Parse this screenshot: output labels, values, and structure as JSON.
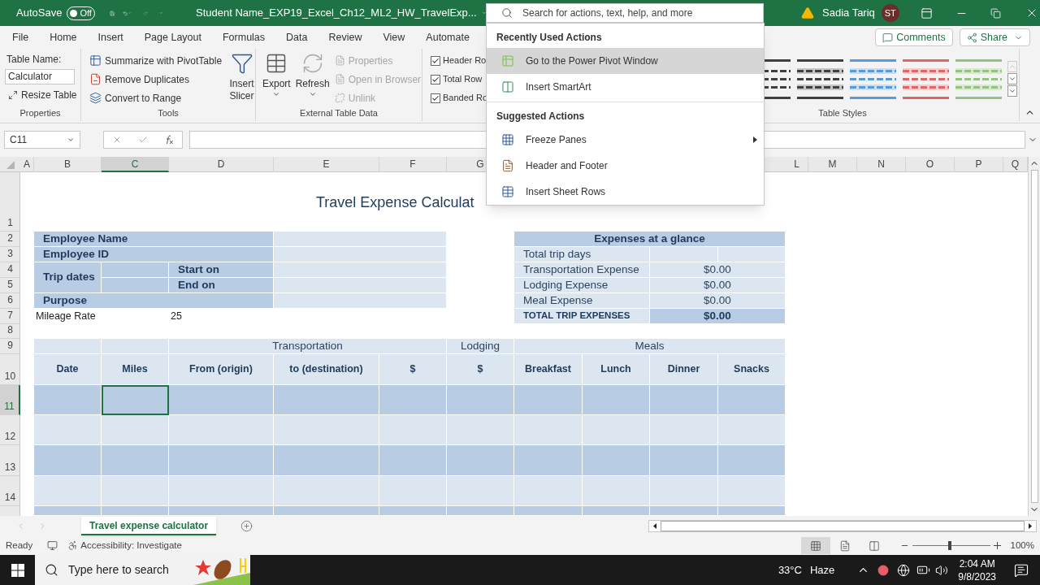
{
  "title_bar": {
    "autosave_label": "AutoSave",
    "autosave": {
      "on": false,
      "label": "Off"
    },
    "file_name": "Student Name_EXP19_Excel_Ch12_ML2_HW_TravelExp...",
    "user_name": "Sadia Tariq",
    "user_initials": "ST"
  },
  "search": {
    "placeholder": "Search for actions, text, help, and more",
    "sections": [
      {
        "heading": "Recently Used Actions",
        "items": [
          {
            "kind": "pivot",
            "label": "Go to the Power Pivot Window",
            "selected": true,
            "submenu": false
          },
          {
            "kind": "smartart",
            "label": "Insert SmartArt",
            "selected": false,
            "submenu": false
          }
        ]
      },
      {
        "heading": "Suggested Actions",
        "items": [
          {
            "kind": "freeze",
            "label": "Freeze Panes",
            "selected": false,
            "submenu": true
          },
          {
            "kind": "header",
            "label": "Header and Footer",
            "selected": false,
            "submenu": false
          },
          {
            "kind": "rows",
            "label": "Insert Sheet Rows",
            "selected": false,
            "submenu": false
          }
        ]
      }
    ]
  },
  "menu_tabs": [
    "File",
    "Home",
    "Insert",
    "Page Layout",
    "Formulas",
    "Data",
    "Review",
    "View",
    "Automate"
  ],
  "comments_button": "Comments",
  "share_button": "Share",
  "ribbon": {
    "properties": {
      "title": "Properties",
      "table_name_label": "Table Name:",
      "table_name": "Calculator",
      "resize": "Resize Table"
    },
    "tools": {
      "title": "Tools",
      "commands": [
        {
          "kind": "pivot",
          "label": "Summarize with PivotTable"
        },
        {
          "kind": "duplicates",
          "label": "Remove Duplicates"
        },
        {
          "kind": "range",
          "label": "Convert to Range"
        }
      ],
      "slicer": "Insert Slicer"
    },
    "external": {
      "title": "External Table Data",
      "export": "Export",
      "refresh": "Refresh",
      "commands": [
        {
          "label": "Properties",
          "disabled": true
        },
        {
          "label": "Open in Browser",
          "disabled": true
        },
        {
          "label": "Unlink",
          "disabled": true
        }
      ]
    },
    "style_options": [
      {
        "label": "Header Ro",
        "checked": true
      },
      {
        "label": "Total Row",
        "checked": true
      },
      {
        "label": "Banded Ro",
        "checked": true
      }
    ],
    "table_styles": {
      "title": "Table Styles",
      "swatches": [
        {
          "color": "#404040"
        },
        {
          "color": "#404040"
        },
        {
          "color": "#5b9bd5"
        },
        {
          "color": "#e06666"
        },
        {
          "color": "#93c47d"
        }
      ]
    }
  },
  "formula_bar": {
    "name_box": "C11"
  },
  "sheet": {
    "columns": [
      {
        "label": "A",
        "selected": false
      },
      {
        "label": "B",
        "selected": false
      },
      {
        "label": "C",
        "selected": true
      },
      {
        "label": "D",
        "selected": false
      },
      {
        "label": "E",
        "selected": false
      },
      {
        "label": "F",
        "selected": false
      },
      {
        "label": "G",
        "selected": false
      },
      {
        "label": "L",
        "selected": false
      },
      {
        "label": "M",
        "selected": false
      },
      {
        "label": "N",
        "selected": false
      },
      {
        "label": "O",
        "selected": false
      },
      {
        "label": "P",
        "selected": false
      },
      {
        "label": "Q",
        "selected": false
      }
    ],
    "rows": [
      {
        "label": "1",
        "selected": false
      },
      {
        "label": "2",
        "selected": false
      },
      {
        "label": "3",
        "selected": false
      },
      {
        "label": "4",
        "selected": false
      },
      {
        "label": "5",
        "selected": false
      },
      {
        "label": "6",
        "selected": false
      },
      {
        "label": "7",
        "selected": false
      },
      {
        "label": "8",
        "selected": false
      },
      {
        "label": "9",
        "selected": false
      },
      {
        "label": "10",
        "selected": false
      },
      {
        "label": "11",
        "selected": true
      },
      {
        "label": "12",
        "selected": false
      },
      {
        "label": "13",
        "selected": false
      },
      {
        "label": "14",
        "selected": false
      }
    ],
    "title": "Travel Expense Calculat",
    "employee_table": {
      "name_label": "Employee Name",
      "id_label": "Employee ID",
      "trip_dates_label": "Trip dates",
      "start_label": "Start on",
      "end_label": "End on",
      "purpose_label": "Purpose"
    },
    "mileage": {
      "label": "Mileage Rate",
      "value": "25"
    },
    "expenses": {
      "title": "Expenses at a glance",
      "rows": [
        {
          "label": "Total trip days"
        },
        {
          "label": "Transportation Expense",
          "value": "$0.00"
        },
        {
          "label": "Lodging Expense",
          "value": "$0.00"
        },
        {
          "label": "Meal Expense",
          "value": "$0.00"
        }
      ],
      "total": {
        "label": "TOTAL TRIP EXPENSES",
        "value": "$0.00"
      }
    },
    "trip_table": {
      "groups": [
        "Transportation",
        "Lodging",
        "Meals"
      ],
      "columns": [
        "Date",
        "Miles",
        "From (origin)",
        "to (destination)",
        "$",
        "$",
        "Breakfast",
        "Lunch",
        "Dinner",
        "Snacks"
      ],
      "entry_rows": [
        {
          "banded": true,
          "cells": [
            {
              "selected": false
            },
            {
              "selected": true
            },
            {
              "selected": false
            },
            {
              "selected": false
            },
            {
              "selected": false
            },
            {
              "selected": false
            },
            {
              "selected": false
            },
            {
              "selected": false
            },
            {
              "selected": false
            },
            {
              "selected": false
            }
          ]
        },
        {
          "banded": false,
          "cells": [
            {
              "selected": false
            },
            {
              "selected": false
            },
            {
              "selected": false
            },
            {
              "selected": false
            },
            {
              "selected": false
            },
            {
              "selected": false
            },
            {
              "selected": false
            },
            {
              "selected": false
            },
            {
              "selected": false
            },
            {
              "selected": false
            }
          ]
        },
        {
          "banded": true,
          "cells": [
            {
              "selected": false
            },
            {
              "selected": false
            },
            {
              "selected": false
            },
            {
              "selected": false
            },
            {
              "selected": false
            },
            {
              "selected": false
            },
            {
              "selected": false
            },
            {
              "selected": false
            },
            {
              "selected": false
            },
            {
              "selected": false
            }
          ]
        },
        {
          "banded": false,
          "cells": [
            {
              "selected": false
            },
            {
              "selected": false
            },
            {
              "selected": false
            },
            {
              "selected": false
            },
            {
              "selected": false
            },
            {
              "selected": false
            },
            {
              "selected": false
            },
            {
              "selected": false
            },
            {
              "selected": false
            },
            {
              "selected": false
            }
          ]
        },
        {
          "banded": true,
          "cells": [
            {
              "selected": false
            },
            {
              "selected": false
            },
            {
              "selected": false
            },
            {
              "selected": false
            },
            {
              "selected": false
            },
            {
              "selected": false
            },
            {
              "selected": false
            },
            {
              "selected": false
            },
            {
              "selected": false
            },
            {
              "selected": false
            }
          ]
        }
      ]
    }
  },
  "sheet_tabs": [
    {
      "label": "Travel expense calculator",
      "selected": true
    }
  ],
  "status_bar": {
    "status": "Ready",
    "accessibility": "Accessibility: Investigate",
    "views": [
      {
        "kind": "normal",
        "selected": true
      },
      {
        "kind": "page_layout",
        "selected": false
      },
      {
        "kind": "page_break",
        "selected": false
      }
    ],
    "zoom": {
      "level": 0.48,
      "label": "100%"
    }
  },
  "taskbar": {
    "search_placeholder": "Type here to search",
    "temperature": "33°C",
    "weather": "Haze",
    "time": "2:04 AM",
    "date": "9/8/2023"
  }
}
